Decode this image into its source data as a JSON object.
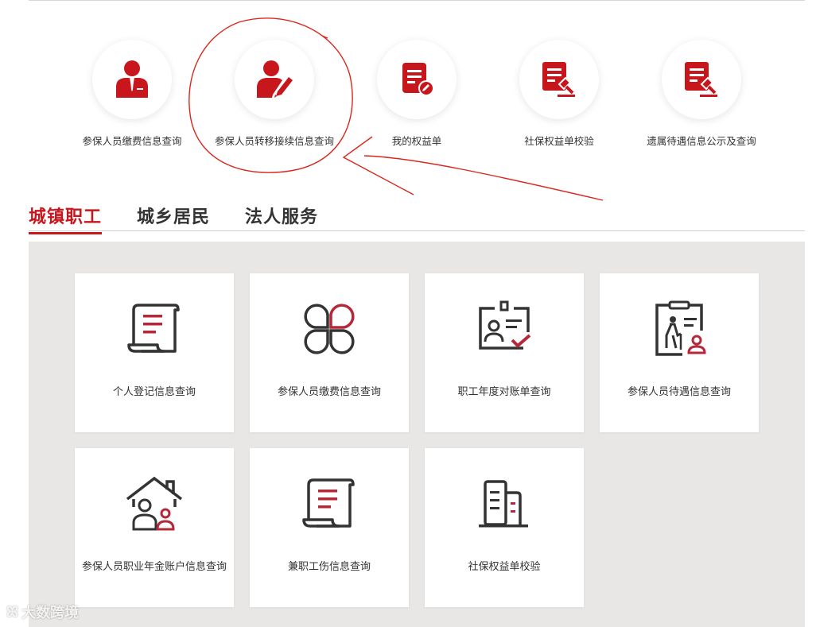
{
  "quick_services": [
    {
      "label": "参保人员缴费信息查询",
      "icon": "official-person-icon"
    },
    {
      "label": "参保人员转移接续信息查询",
      "icon": "person-edit-icon"
    },
    {
      "label": "我的权益单",
      "icon": "document-edit-icon"
    },
    {
      "label": "社保权益单校验",
      "icon": "document-gavel-icon"
    },
    {
      "label": "遗属待遇信息公示及查询",
      "icon": "document-gavel-icon"
    }
  ],
  "tabs": [
    {
      "label": "城镇职工",
      "active": true
    },
    {
      "label": "城乡居民",
      "active": false
    },
    {
      "label": "法人服务",
      "active": false
    }
  ],
  "cards": [
    {
      "label": "个人登记信息查询",
      "icon": "scroll-document-icon"
    },
    {
      "label": "参保人员缴费信息查询",
      "icon": "four-petal-icon"
    },
    {
      "label": "职工年度对账单查询",
      "icon": "id-card-check-icon"
    },
    {
      "label": "参保人员待遇信息查询",
      "icon": "elderly-clipboard-icon"
    },
    {
      "label": "参保人员职业年金账户信息查询",
      "icon": "house-family-icon"
    },
    {
      "label": "兼职工伤信息查询",
      "icon": "scroll-document-icon"
    },
    {
      "label": "社保权益单校验",
      "icon": "buildings-icon"
    }
  ],
  "watermark": "大数跨境",
  "colors": {
    "brand_red": "#c8161d",
    "icon_dark": "#333333",
    "panel_bg": "#e8e7e5"
  }
}
